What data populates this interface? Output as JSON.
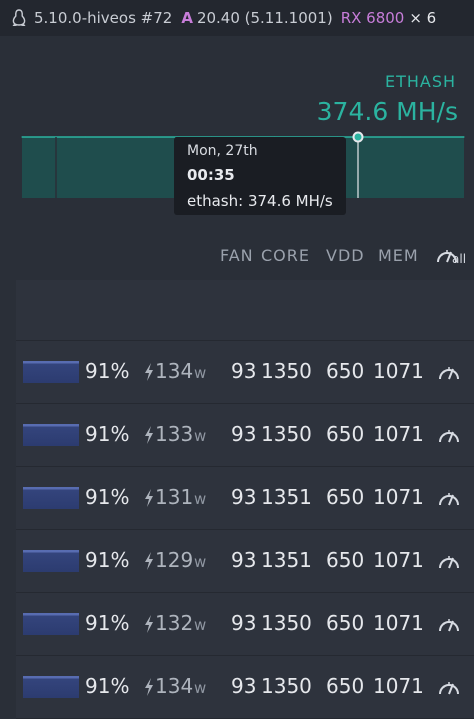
{
  "topbar": {
    "kernel": "5.10.0-hiveos #72",
    "amd_letter": "A",
    "driver": "20.40 (5.11.1001)",
    "gpu_model": "RX 6800",
    "gpu_count": "× 6",
    "os_icon": "linux-penguin-icon"
  },
  "summary": {
    "algo": "ETHASH",
    "hashrate": "374.6 MH/s"
  },
  "chart_data": {
    "type": "area",
    "series": [
      {
        "values": [
          374.6,
          374.6,
          374.6,
          374.6,
          374.6,
          374.6,
          374.6,
          374.6
        ]
      }
    ],
    "tooltip_selected": {
      "date": "Mon, 27th",
      "time": "00:35",
      "value": 374.6
    }
  },
  "tooltip": {
    "date": "Mon, 27th",
    "time": "00:35",
    "value": "ethash: 374.6 MH/s"
  },
  "columns": {
    "fan": "FAN",
    "core": "CORE",
    "vdd": "VDD",
    "mem": "MEM",
    "all": "all",
    "all_icon": "gauge-icon"
  },
  "gpus": [
    {
      "fan_level": 0.91,
      "fan": "91%",
      "power": "134",
      "power_unit": "w",
      "temp": "93",
      "core": "1350",
      "vdd": "650",
      "mem": "1071"
    },
    {
      "fan_level": 0.91,
      "fan": "91%",
      "power": "133",
      "power_unit": "w",
      "temp": "93",
      "core": "1350",
      "vdd": "650",
      "mem": "1071"
    },
    {
      "fan_level": 0.91,
      "fan": "91%",
      "power": "131",
      "power_unit": "w",
      "temp": "93",
      "core": "1351",
      "vdd": "650",
      "mem": "1071"
    },
    {
      "fan_level": 0.91,
      "fan": "91%",
      "power": "129",
      "power_unit": "w",
      "temp": "93",
      "core": "1351",
      "vdd": "650",
      "mem": "1071"
    },
    {
      "fan_level": 0.91,
      "fan": "91%",
      "power": "132",
      "power_unit": "w",
      "temp": "93",
      "core": "1350",
      "vdd": "650",
      "mem": "1071"
    },
    {
      "fan_level": 0.91,
      "fan": "91%",
      "power": "134",
      "power_unit": "w",
      "temp": "93",
      "core": "1350",
      "vdd": "650",
      "mem": "1071"
    }
  ],
  "colors": {
    "accent": "#2bb3a0",
    "amd": "#c77dd9",
    "background": "#2a2f38"
  }
}
